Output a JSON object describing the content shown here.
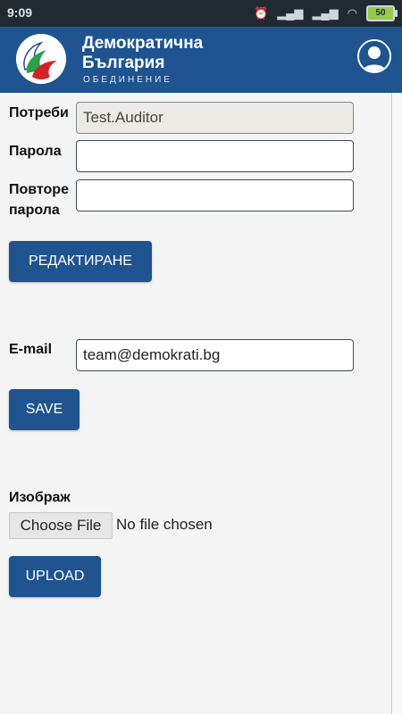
{
  "status_bar": {
    "time": "9:09",
    "battery": "50"
  },
  "header": {
    "brand_line1": "Демократична",
    "brand_line2": "България",
    "brand_sub": "ОБЕДИНЕНИЕ",
    "color": "#1f5490"
  },
  "form": {
    "username_label": "Потреби",
    "username_value": "Test.Auditor",
    "password_label": "Парола",
    "password_value": "",
    "repeat_password_label_line1": "Повторе",
    "repeat_password_label_line2": "парола",
    "repeat_password_value": "",
    "edit_button": "РЕДАКТИРАНЕ",
    "email_label": "E-mail",
    "email_value": "team@demokrati.bg",
    "save_button": "SAVE",
    "image_label": "Изображ",
    "choose_file_button": "Choose File",
    "file_status": "No file chosen",
    "upload_button": "UPLOAD"
  },
  "colors": {
    "accent": "#1f5490",
    "flag_white": "#ffffff",
    "flag_green": "#2aa14a",
    "flag_red": "#d2232a"
  },
  "icons": [
    "wifi-icon",
    "signal-icon",
    "alarm-icon",
    "avatar-icon",
    "logo-icon"
  ]
}
